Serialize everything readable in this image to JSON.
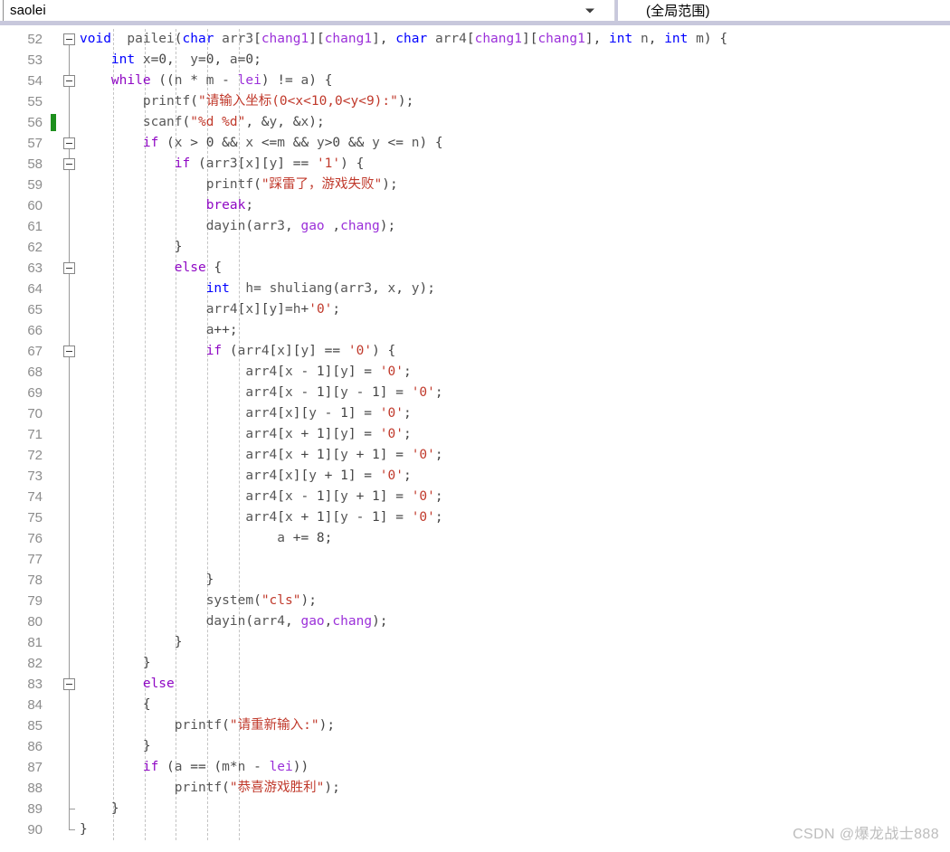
{
  "toolbar": {
    "scope_value": "saolei",
    "scope_placeholder": "saolei",
    "member_value": "(全局范围)",
    "dropdown_icon": "chevron-down-icon"
  },
  "editor": {
    "first_line": 52,
    "last_line": 90,
    "change_marker_line": 56,
    "language": "C",
    "colors": {
      "keyword": "#0000ff",
      "control": "#8f08c4",
      "macro": "#9b30d9",
      "string": "#c0392b",
      "identifier": "#575757",
      "line_number": "#8c8c8c",
      "change_marker": "#1d8f1d",
      "toolbar_divider": "#c8c8dc"
    },
    "line_numbers": [
      52,
      53,
      54,
      55,
      56,
      57,
      58,
      59,
      60,
      61,
      62,
      63,
      64,
      65,
      66,
      67,
      68,
      69,
      70,
      71,
      72,
      73,
      74,
      75,
      76,
      77,
      78,
      79,
      80,
      81,
      82,
      83,
      84,
      85,
      86,
      87,
      88,
      89,
      90
    ],
    "lines": [
      {
        "n": 52,
        "fold": "open",
        "text": "void  pailei(char arr3[chang1][chang1], char arr4[chang1][chang1], int n, int m) {"
      },
      {
        "n": 53,
        "fold": "none",
        "text": "    int x=0,  y=0, a=0;"
      },
      {
        "n": 54,
        "fold": "open",
        "text": "    while ((n * m - lei) != a) {"
      },
      {
        "n": 55,
        "fold": "none",
        "text": "        printf(\"请输入坐标(0<x<10,0<y<9):\");"
      },
      {
        "n": 56,
        "fold": "none",
        "text": "        scanf(\"%d %d\", &y, &x);"
      },
      {
        "n": 57,
        "fold": "open",
        "text": "        if (x > 0 && x <=m && y>0 && y <= n) {"
      },
      {
        "n": 58,
        "fold": "open",
        "text": "            if (arr3[x][y] == '1') {"
      },
      {
        "n": 59,
        "fold": "none",
        "text": "                printf(\"踩雷了，游戏失败\");"
      },
      {
        "n": 60,
        "fold": "none",
        "text": "                break;"
      },
      {
        "n": 61,
        "fold": "none",
        "text": "                dayin(arr3, gao ,chang);"
      },
      {
        "n": 62,
        "fold": "none",
        "text": "            }"
      },
      {
        "n": 63,
        "fold": "open",
        "text": "            else {"
      },
      {
        "n": 64,
        "fold": "none",
        "text": "                int  h= shuliang(arr3, x, y);"
      },
      {
        "n": 65,
        "fold": "none",
        "text": "                arr4[x][y]=h+'0';"
      },
      {
        "n": 66,
        "fold": "none",
        "text": "                a++;"
      },
      {
        "n": 67,
        "fold": "open",
        "text": "                if (arr4[x][y] == '0') {"
      },
      {
        "n": 68,
        "fold": "none",
        "text": "                     arr4[x - 1][y] = '0';"
      },
      {
        "n": 69,
        "fold": "none",
        "text": "                     arr4[x - 1][y - 1] = '0';"
      },
      {
        "n": 70,
        "fold": "none",
        "text": "                     arr4[x][y - 1] = '0';"
      },
      {
        "n": 71,
        "fold": "none",
        "text": "                     arr4[x + 1][y] = '0';"
      },
      {
        "n": 72,
        "fold": "none",
        "text": "                     arr4[x + 1][y + 1] = '0';"
      },
      {
        "n": 73,
        "fold": "none",
        "text": "                     arr4[x][y + 1] = '0';"
      },
      {
        "n": 74,
        "fold": "none",
        "text": "                     arr4[x - 1][y + 1] = '0';"
      },
      {
        "n": 75,
        "fold": "none",
        "text": "                     arr4[x + 1][y - 1] = '0';"
      },
      {
        "n": 76,
        "fold": "none",
        "text": "                         a += 8;"
      },
      {
        "n": 77,
        "fold": "none",
        "text": ""
      },
      {
        "n": 78,
        "fold": "none",
        "text": "                }"
      },
      {
        "n": 79,
        "fold": "none",
        "text": "                system(\"cls\");"
      },
      {
        "n": 80,
        "fold": "none",
        "text": "                dayin(arr4, gao,chang);"
      },
      {
        "n": 81,
        "fold": "none",
        "text": "            }"
      },
      {
        "n": 82,
        "fold": "none",
        "text": "        }"
      },
      {
        "n": 83,
        "fold": "open",
        "text": "        else"
      },
      {
        "n": 84,
        "fold": "none",
        "text": "        {"
      },
      {
        "n": 85,
        "fold": "none",
        "text": "            printf(\"请重新输入:\");"
      },
      {
        "n": 86,
        "fold": "none",
        "text": "        }"
      },
      {
        "n": 87,
        "fold": "none",
        "text": "        if (a == (m*n - lei))"
      },
      {
        "n": 88,
        "fold": "none",
        "text": "            printf(\"恭喜游戏胜利\");"
      },
      {
        "n": 89,
        "fold": "none",
        "text": "    }"
      },
      {
        "n": 90,
        "fold": "none",
        "text": "}"
      }
    ]
  },
  "watermark": {
    "text": "CSDN @爆龙战士888"
  }
}
